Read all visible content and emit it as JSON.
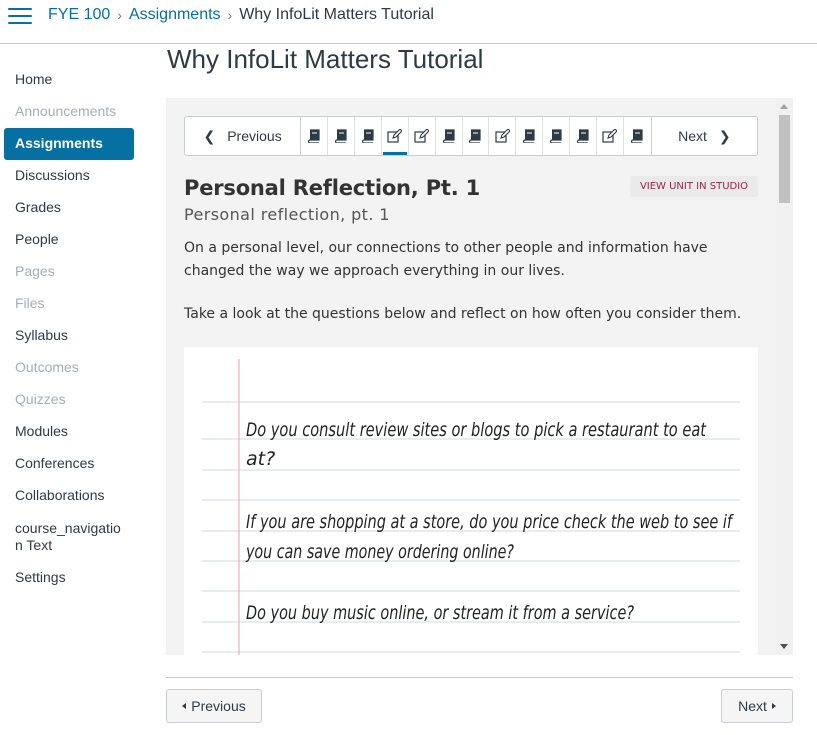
{
  "breadcrumb": {
    "course": "FYE 100",
    "section": "Assignments",
    "current": "Why InfoLit Matters Tutorial"
  },
  "sidebar": {
    "items": [
      {
        "label": "Home",
        "state": "normal"
      },
      {
        "label": "Announcements",
        "state": "disabled"
      },
      {
        "label": "Assignments",
        "state": "active"
      },
      {
        "label": "Discussions",
        "state": "normal"
      },
      {
        "label": "Grades",
        "state": "normal"
      },
      {
        "label": "People",
        "state": "normal"
      },
      {
        "label": "Pages",
        "state": "disabled"
      },
      {
        "label": "Files",
        "state": "disabled"
      },
      {
        "label": "Syllabus",
        "state": "normal"
      },
      {
        "label": "Outcomes",
        "state": "disabled"
      },
      {
        "label": "Quizzes",
        "state": "disabled"
      },
      {
        "label": "Modules",
        "state": "normal"
      },
      {
        "label": "Conferences",
        "state": "normal"
      },
      {
        "label": "Collaborations",
        "state": "normal"
      },
      {
        "label": "course_navigatio\nn Text",
        "state": "normal"
      },
      {
        "label": "Settings",
        "state": "normal"
      }
    ]
  },
  "page": {
    "title": "Why InfoLit Matters Tutorial"
  },
  "unit_nav": {
    "previous_label": "Previous",
    "next_label": "Next",
    "units": [
      {
        "icon": "book-icon"
      },
      {
        "icon": "book-icon"
      },
      {
        "icon": "book-icon"
      },
      {
        "icon": "edit-icon",
        "current": true
      },
      {
        "icon": "edit-icon"
      },
      {
        "icon": "book-icon"
      },
      {
        "icon": "book-icon"
      },
      {
        "icon": "edit-icon"
      },
      {
        "icon": "book-icon"
      },
      {
        "icon": "book-icon"
      },
      {
        "icon": "book-icon"
      },
      {
        "icon": "edit-icon"
      },
      {
        "icon": "book-icon"
      }
    ]
  },
  "lesson": {
    "title": "Personal Reflection, Pt. 1",
    "subtitle": "Personal reflection, pt. 1",
    "studio_link": "VIEW UNIT IN STUDIO",
    "paragraph1": "On a personal level, our connections to other people and information have changed the way we approach everything in our lives.",
    "paragraph2": "Take a look at the questions below and reflect on how often you consider them."
  },
  "notebook": {
    "questions": [
      {
        "line1": "Do you consult review sites or blogs to pick a restaurant to eat",
        "line2": "at?"
      },
      {
        "line1": "If you are shopping at a store, do you price check the web to see if",
        "line2": "you can save money ordering online?"
      },
      {
        "line1": "Do you buy music online, or stream it from a service?",
        "line2": ""
      }
    ]
  },
  "footer": {
    "previous_label": "Previous",
    "next_label": "Next"
  },
  "colors": {
    "link": "#0770a3",
    "active_nav": "#0770a3",
    "studio_text": "#a0254c",
    "notebook_rule": "#c9d8ec",
    "notebook_margin": "#e8a0a8"
  }
}
